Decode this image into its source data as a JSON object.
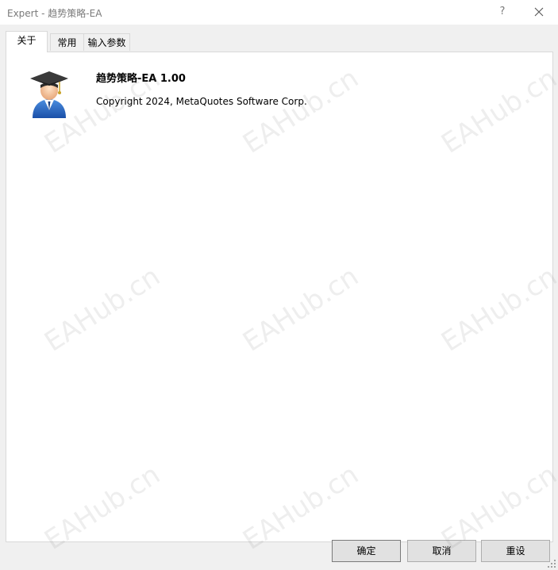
{
  "window": {
    "title": "Expert - 趋势策略-EA",
    "help_label": "?"
  },
  "tabs": [
    {
      "label": "关于",
      "active": true
    },
    {
      "label": "常用",
      "active": false
    },
    {
      "label": "输入参数",
      "active": false
    }
  ],
  "about": {
    "ea_name": "趋势策略-EA 1.00",
    "copyright": "Copyright 2024, MetaQuotes Software Corp.",
    "icon": "graduate-avatar-icon"
  },
  "buttons": {
    "ok": "确定",
    "cancel": "取消",
    "reset": "重设"
  },
  "watermark": "EAHub.cn",
  "colors": {
    "title_text": "#7a7a7a",
    "panel_bg": "#ffffff",
    "dialog_bg": "#f0f0f0",
    "button_bg": "#e1e1e1"
  }
}
